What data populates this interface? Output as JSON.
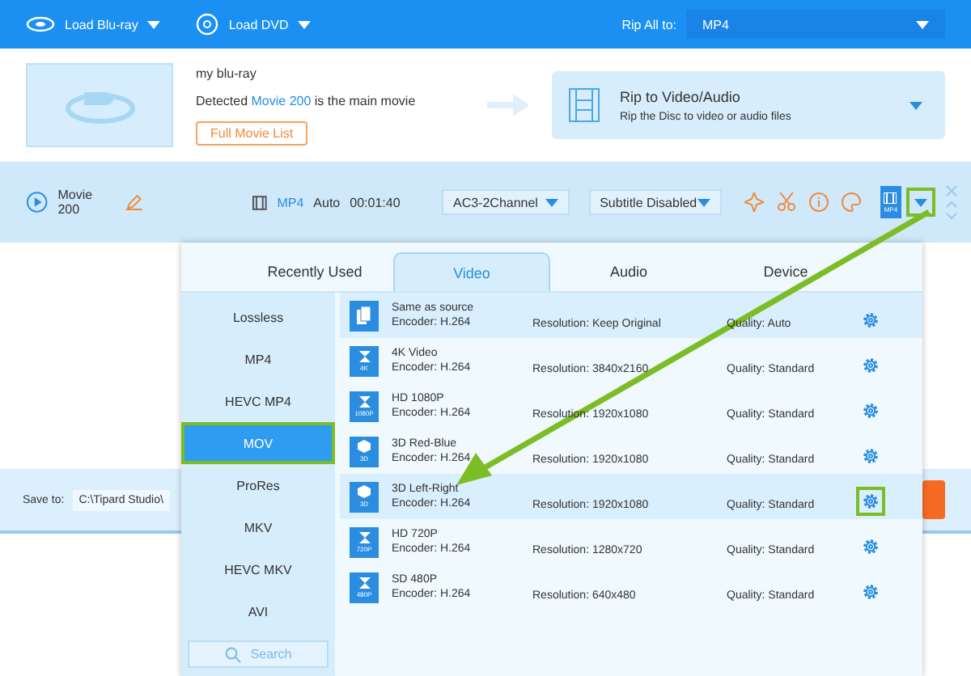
{
  "toolbar": {
    "load_bluray": "Load Blu-ray",
    "load_dvd": "Load DVD",
    "rip_all_label": "Rip All to:",
    "rip_all_value": "MP4"
  },
  "source": {
    "title": "my blu-ray",
    "detected": "Detected **Movie 200** is the main movie",
    "full_list_button": "Full Movie List"
  },
  "rip_mode": {
    "title": "Rip to Video/Audio",
    "subtitle": "Rip the Disc to video or audio files"
  },
  "movie": {
    "name": "Movie 200",
    "format": "MP4",
    "quality": "Auto",
    "duration": "00:01:40",
    "audio": "AC3-2Channel",
    "subtitle": "Subtitle Disabled",
    "format_badge": "MP4",
    "format_dropdown_highlighted": true
  },
  "save_bar": {
    "label": "Save to:",
    "path": "C:\\Tipard Studio\\"
  },
  "format_panel": {
    "tabs": [
      {
        "label": "Recently Used",
        "selected": false
      },
      {
        "label": "Video",
        "selected": true
      },
      {
        "label": "Audio",
        "selected": false
      },
      {
        "label": "Device",
        "selected": false
      }
    ],
    "categories": [
      {
        "label": "Lossless",
        "selected": false,
        "highlighted": false
      },
      {
        "label": "MP4",
        "selected": false,
        "highlighted": false
      },
      {
        "label": "HEVC MP4",
        "selected": false,
        "highlighted": false
      },
      {
        "label": "MOV",
        "selected": true,
        "highlighted": true
      },
      {
        "label": "ProRes",
        "selected": false,
        "highlighted": false
      },
      {
        "label": "MKV",
        "selected": false,
        "highlighted": false
      },
      {
        "label": "HEVC MKV",
        "selected": false,
        "highlighted": false
      },
      {
        "label": "AVI",
        "selected": false,
        "highlighted": false
      }
    ],
    "search_placeholder": "Search",
    "profiles": [
      {
        "kind": "copy",
        "name": "Same as source",
        "encoder": "Encoder: H.264",
        "resolution": "Resolution: Keep Original",
        "quality": "Quality: Auto",
        "selected": true,
        "gear_highlighted": false
      },
      {
        "kind": "video",
        "icon_label": "4K",
        "name": "4K Video",
        "encoder": "Encoder: H.264",
        "resolution": "Resolution: 3840x2160",
        "quality": "Quality: Standard",
        "selected": false,
        "gear_highlighted": false
      },
      {
        "kind": "video",
        "icon_label": "1080P",
        "name": "HD 1080P",
        "encoder": "Encoder: H.264",
        "resolution": "Resolution: 1920x1080",
        "quality": "Quality: Standard",
        "selected": false,
        "gear_highlighted": false
      },
      {
        "kind": "cube",
        "icon_label": "3D",
        "name": "3D Red-Blue",
        "encoder": "Encoder: H.264",
        "resolution": "Resolution: 1920x1080",
        "quality": "Quality: Standard",
        "selected": false,
        "gear_highlighted": false
      },
      {
        "kind": "cube",
        "icon_label": "3D",
        "name": "3D Left-Right",
        "encoder": "Encoder: H.264",
        "resolution": "Resolution: 1920x1080",
        "quality": "Quality: Standard",
        "selected": true,
        "gear_highlighted": true
      },
      {
        "kind": "video",
        "icon_label": "720P",
        "name": "HD 720P",
        "encoder": "Encoder: H.264",
        "resolution": "Resolution: 1280x720",
        "quality": "Quality: Standard",
        "selected": false,
        "gear_highlighted": false
      },
      {
        "kind": "video",
        "icon_label": "480P",
        "name": "SD 480P",
        "encoder": "Encoder: H.264",
        "resolution": "Resolution: 640x480",
        "quality": "Quality: Standard",
        "selected": false,
        "gear_highlighted": false
      }
    ]
  }
}
